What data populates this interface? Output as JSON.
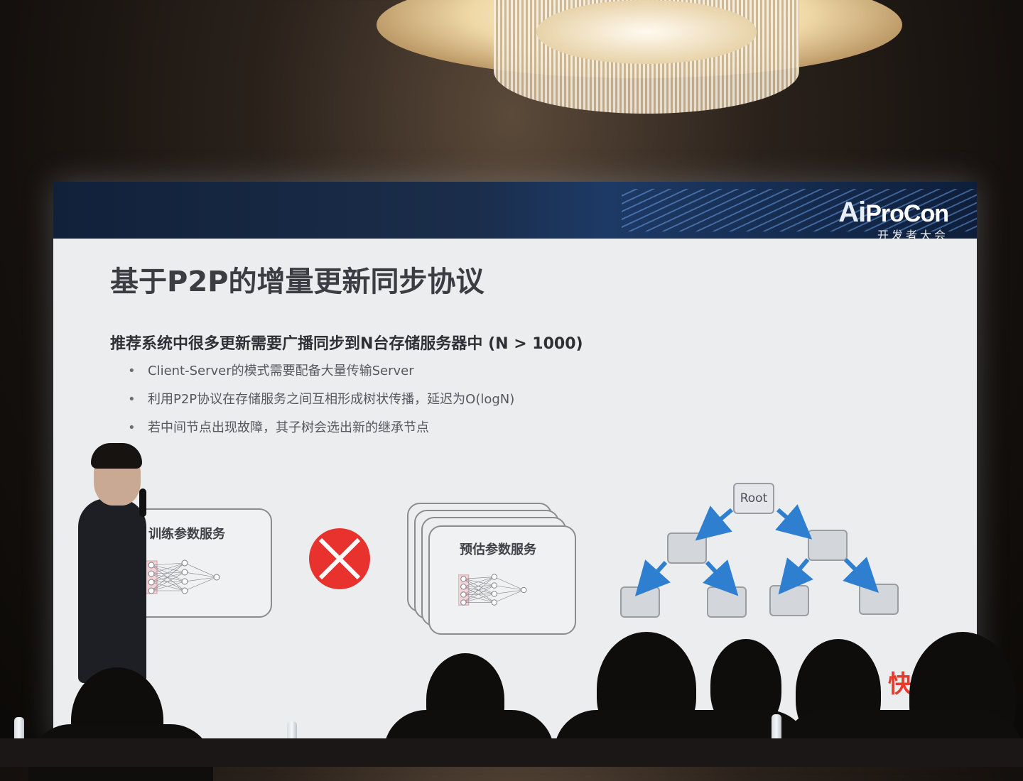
{
  "slide": {
    "logo_main": "ProCon",
    "logo_prefix": "Ai",
    "logo_sub": "开发者大会",
    "title": "基于P2P的增量更新同步协议",
    "subtitle": "推荐系统中很多更新需要广播同步到N台存储服务器中 (N > 1000)",
    "bullets": [
      "Client-Server的模式需要配备大量传输Server",
      "利用P2P协议在存储服务之间互相形成树状传播，延迟为O(logN)",
      "若中间节点出现故障，其子树会选出新的继承节点"
    ],
    "diagram": {
      "training_label": "训练参数服务",
      "serving_label": "预估参数服务",
      "root_label": "Root"
    },
    "brand_partial": "快"
  },
  "colors": {
    "banner": "#12213a",
    "cross": "#e8322e",
    "arrow": "#2f7fd1",
    "slide_bg": "#ecedef"
  }
}
